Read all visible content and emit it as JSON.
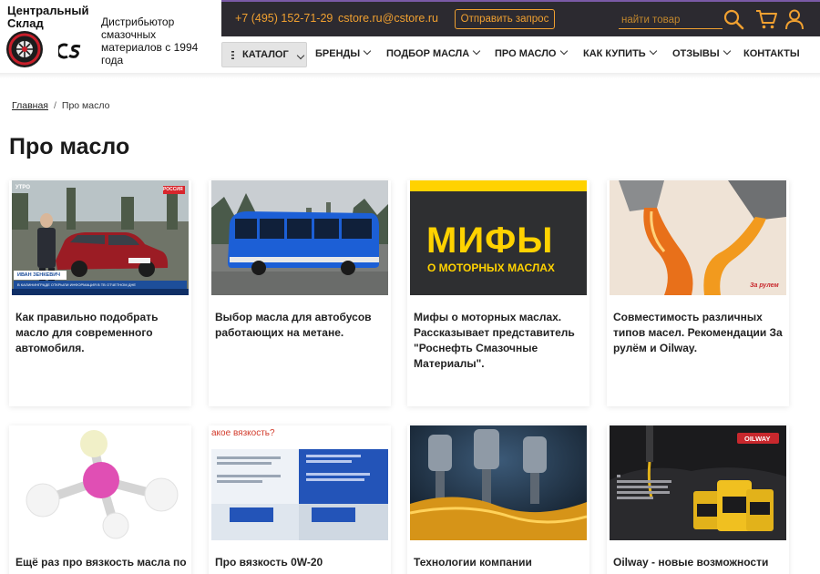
{
  "brand": {
    "name_line1": "Центральный",
    "name_line2": "Склад",
    "tagline": "Дистрибьютор смазочных материалов с 1994 года"
  },
  "topbar": {
    "phone": "+7 (495) 152-71-29",
    "email": "cstore.ru@cstore.ru",
    "request_label": "Отправить запрос",
    "search_placeholder": "найти товар",
    "icons": [
      "search-icon",
      "cart-icon",
      "user-icon"
    ],
    "accent_color": "#f0a030",
    "background_color": "#2c2a30"
  },
  "nav": {
    "catalog_label": "КАТАЛОГ",
    "items": [
      {
        "label": "БРЕНДЫ",
        "dropdown": true
      },
      {
        "label": "ПОДБОР МАСЛА",
        "dropdown": true
      },
      {
        "label": "ПРО МАСЛО",
        "dropdown": true
      },
      {
        "label": "КАК КУПИТЬ",
        "dropdown": true
      },
      {
        "label": "ОТЗЫВЫ",
        "dropdown": true
      },
      {
        "label": "КОНТАКТЫ",
        "dropdown": false
      }
    ]
  },
  "breadcrumb": {
    "home": "Главная",
    "separator": "/",
    "current": "Про масло"
  },
  "page_title": "Про масло",
  "cards": [
    {
      "title": "Как правильно подобрать масло для современного автомобиля.",
      "image": "red-car-tv-report",
      "image_text": {
        "channel": "УТРО",
        "network": "РОССИЯ",
        "name": "ИВАН ЗЕНКЕВИЧ",
        "ticker": "В КАЛИНИНГРАДЕ ОТКРЫЛИ ИНФОРМАЦИЯ В ТВ ОТЧЕТНОМ ДНЕ"
      }
    },
    {
      "title": "Выбор масла для автобусов работающих на метане.",
      "image": "blue-city-bus"
    },
    {
      "title": "Мифы о моторных маслах. Рассказывает представитель \"Роснефть Смазочные Материалы\".",
      "image": "myths-banner",
      "image_text": {
        "headline": "МИФЫ",
        "subline": "О МОТОРНЫХ МАСЛАХ"
      }
    },
    {
      "title": "Совместимость различных типов масел. Рекомендации За рулём и Oilway.",
      "image": "oil-pouring",
      "image_text": {
        "watermark": "За рулем"
      }
    },
    {
      "title": "Ещё раз про вязкость масла по",
      "image": "molecule-model"
    },
    {
      "title": "Про вязкость 0W-20",
      "image": "viscosity-slides",
      "image_text": {
        "heading": "акое вязкость?"
      }
    },
    {
      "title": "Технологии компании",
      "image": "engine-pistons-oil"
    },
    {
      "title": "Oilway - новые возможности для",
      "image": "oilway-canisters",
      "image_text": {
        "logo": "OILWAY"
      }
    }
  ]
}
